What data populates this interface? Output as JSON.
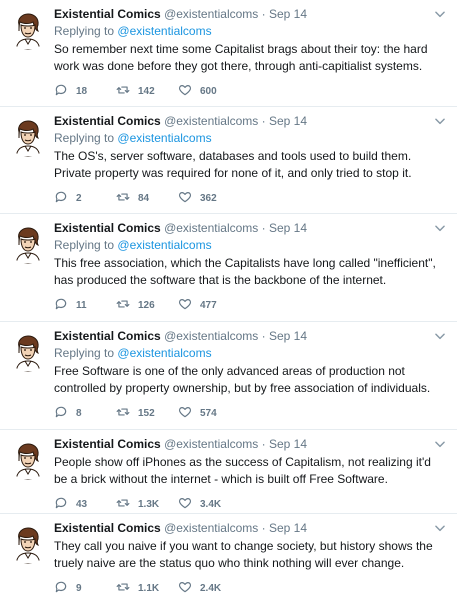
{
  "author": {
    "name": "Existential Comics",
    "handle": "@existentialcoms"
  },
  "tweets": [
    {
      "date": "Sep 14",
      "replying_prefix": "Replying to",
      "replying_to": "@existentialcoms",
      "text": "So remember next time some Capitalist brags about their toy: the hard work was done before they got there, through anti-capitialist systems.",
      "replies": "18",
      "retweets": "142",
      "likes": "600"
    },
    {
      "date": "Sep 14",
      "replying_prefix": "Replying to",
      "replying_to": "@existentialcoms",
      "text": "The OS's, server software, databases and tools used to build them. Private property was required for none of it, and only tried to stop it.",
      "replies": "2",
      "retweets": "84",
      "likes": "362"
    },
    {
      "date": "Sep 14",
      "replying_prefix": "Replying to",
      "replying_to": "@existentialcoms",
      "text": "This free association, which the Capitalists have long called \"inefficient\", has produced the software that is the backbone of the internet.",
      "replies": "11",
      "retweets": "126",
      "likes": "477"
    },
    {
      "date": "Sep 14",
      "replying_prefix": "Replying to",
      "replying_to": "@existentialcoms",
      "text": "Free Software is one of the only advanced areas of production not controlled by property ownership, but by free association of individuals.",
      "replies": "8",
      "retweets": "152",
      "likes": "574"
    },
    {
      "date": "Sep 14",
      "text": "People show off iPhones as the success of Capitalism, not realizing it'd be a brick without the internet - which is built off Free Software.",
      "replies": "43",
      "retweets": "1.3K",
      "likes": "3.4K"
    },
    {
      "date": "Sep 14",
      "text": "They call you naive if you want to change society, but history shows the truely naive are the status quo who think nothing will ever change.",
      "replies": "9",
      "retweets": "1.1K",
      "likes": "2.4K"
    }
  ],
  "icons": {
    "reply": "reply-icon",
    "retweet": "retweet-icon",
    "like": "heart-icon",
    "menu": "chevron-down-icon",
    "avatar": "avatar-illustration"
  },
  "colors": {
    "link": "#1b95e0",
    "muted": "#657786",
    "text": "#14171a",
    "divider": "#e6ecf0"
  }
}
